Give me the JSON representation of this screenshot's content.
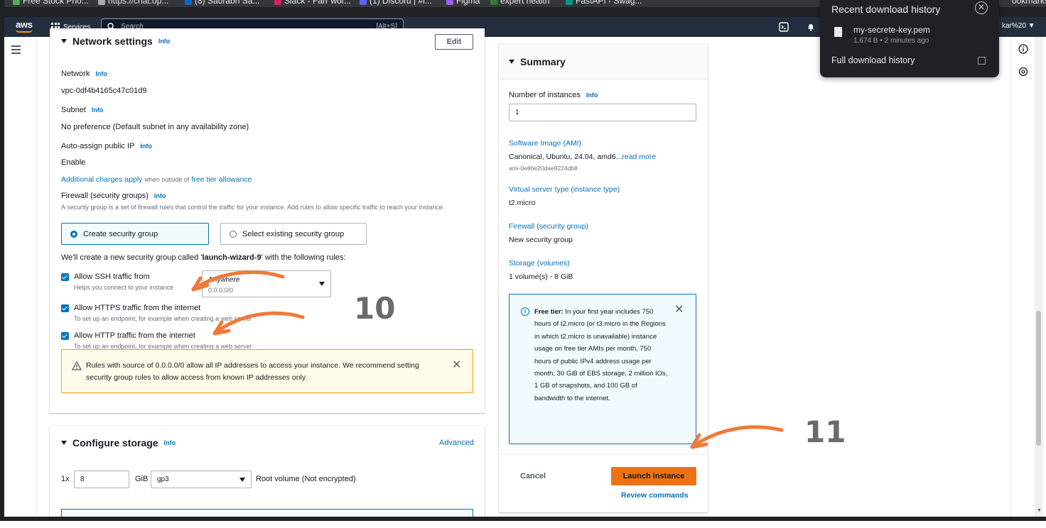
{
  "bookmarks": {
    "items": [
      "Free Stock Pho...",
      "https://chat.op...",
      "(8) Saurabh Sa...",
      "Slack - Farr wor...",
      "(1) Discord | #i...",
      "Figma",
      "expert health",
      "FastAPI - Swag...",
      "ookmarks"
    ]
  },
  "topnav": {
    "logo": "aws",
    "services_label": "Services",
    "search_placeholder": "Search",
    "search_shortcut": "[Alt+S]",
    "account_label": "kar%20 ▼"
  },
  "download_popup": {
    "title": "Recent download history",
    "file_name": "my-secrete-key.pem",
    "file_meta": "1,674 B • 2 minutes ago",
    "full_history_label": "Full download history"
  },
  "network_settings": {
    "title": "Network settings",
    "info": "Info",
    "edit_label": "Edit",
    "network_label": "Network",
    "network_value": "vpc-0df4b4165c47c01d9",
    "subnet_label": "Subnet",
    "subnet_value": "No preference (Default subnet in any availability zone)",
    "auto_ip_label": "Auto-assign public IP",
    "auto_ip_value": "Enable",
    "charges_link": "Additional charges apply",
    "charges_mid": "when outside of",
    "charges_link2": "free tier allowance",
    "firewall_label": "Firewall (security groups)",
    "firewall_desc": "A security group is a set of firewall rules that control the traffic for your instance. Add rules to allow specific traffic to reach your instance.",
    "option_create": "Create security group",
    "option_existing": "Select existing security group",
    "sg_notice_pre": "We'll create a new security group called '",
    "sg_notice_name": "launch-wizard-9",
    "sg_notice_post": "' with the following rules:",
    "ssh_label": "Allow SSH traffic from",
    "ssh_sub": "Helps you connect to your instance",
    "ssh_select_value": "Anywhere",
    "ssh_select_sub": "0.0.0.0/0",
    "https_label": "Allow HTTPS traffic from the internet",
    "https_sub": "To set up an endpoint, for example when creating a web server",
    "http_label": "Allow HTTP traffic from the internet",
    "http_sub": "To set up an endpoint, for example when creating a web server",
    "warning_text": "Rules with source of 0.0.0.0/0 allow all IP addresses to access your instance. We recommend setting security group rules to allow access from known IP addresses only."
  },
  "configure_storage": {
    "title": "Configure storage",
    "info": "Info",
    "advanced_label": "Advanced",
    "multiplier": "1x",
    "size_value": "8",
    "unit": "GiB",
    "volume_type": "gp3",
    "root_label": "Root volume  (Not encrypted)"
  },
  "summary": {
    "title": "Summary",
    "instances_label": "Number of instances",
    "info": "Info",
    "instances_value": "1",
    "ami_label": "Software Image (AMI)",
    "ami_value": "Canonical, Ubuntu, 24.04, amd6...",
    "ami_read_more": "read more",
    "ami_id": "ami-0e86e20dae9224db8",
    "instance_type_label": "Virtual server type (instance type)",
    "instance_type_value": "t2.micro",
    "firewall_label": "Firewall (security group)",
    "firewall_value": "New security group",
    "storage_label": "Storage (volumes)",
    "storage_value": "1 volume(s) - 8 GiB",
    "free_tier_bold": "Free tier:",
    "free_tier_text": "In your first year includes 750 hours of t2.micro (or t3.micro in the Regions in which t2.micro is unavailable) instance usage on free tier AMIs per month, 750 hours of public IPv4 address usage per month, 30 GiB of EBS storage, 2 million IOs, 1 GB of snapshots, and 100 GB of bandwidth to the internet.",
    "cancel_label": "Cancel",
    "launch_label": "Launch instance",
    "review_label": "Review commands"
  },
  "annotations": {
    "step_a": "10",
    "step_b": "11"
  },
  "colors": {
    "aws_nav": "#232f3e",
    "link_blue": "#0073bb",
    "launch_orange": "#ec7211",
    "arrow_orange": "#f07a3a"
  }
}
